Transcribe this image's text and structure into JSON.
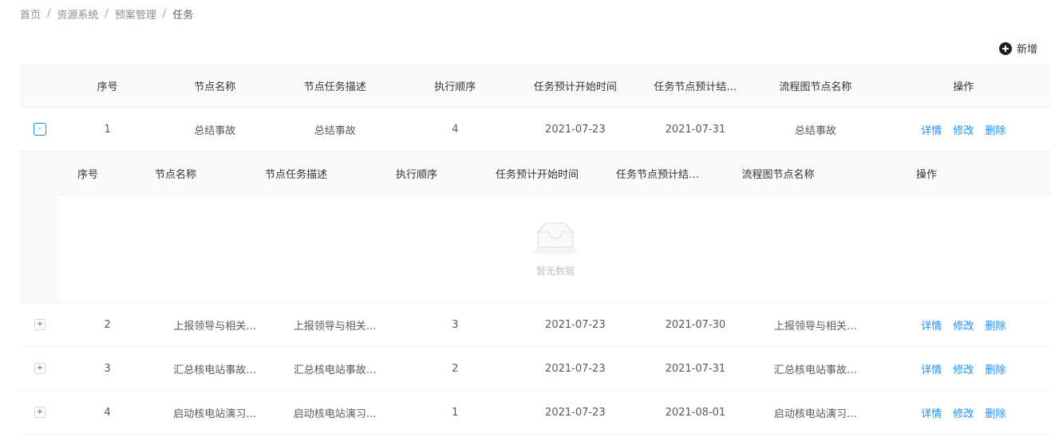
{
  "breadcrumb": {
    "items": [
      "首页",
      "资源系统",
      "预案管理",
      "任务"
    ],
    "separator": "/"
  },
  "toolbar": {
    "add_label": "新增"
  },
  "table": {
    "columns": [
      "序号",
      "节点名称",
      "节点任务描述",
      "执行顺序",
      "任务预计开始时间",
      "任务节点预计结…",
      "流程图节点名称",
      "操作"
    ],
    "rows": [
      {
        "expander": "-",
        "index": "1",
        "name": "总结事故",
        "desc": "总结事故",
        "order": "4",
        "start": "2021-07-23",
        "end": "2021-07-31",
        "flow": "总结事故",
        "ops": [
          "详情",
          "修改",
          "删除"
        ]
      },
      {
        "expander": "+",
        "index": "2",
        "name": "上报领导与相关…",
        "desc": "上报领导与相关…",
        "order": "3",
        "start": "2021-07-23",
        "end": "2021-07-30",
        "flow": "上报领导与相关…",
        "ops": [
          "详情",
          "修改",
          "删除"
        ]
      },
      {
        "expander": "+",
        "index": "3",
        "name": "汇总核电站事故…",
        "desc": "汇总核电站事故…",
        "order": "2",
        "start": "2021-07-23",
        "end": "2021-07-31",
        "flow": "汇总核电站事故…",
        "ops": [
          "详情",
          "修改",
          "删除"
        ]
      },
      {
        "expander": "+",
        "index": "4",
        "name": "启动核电站演习…",
        "desc": "启动核电站演习…",
        "order": "1",
        "start": "2021-07-23",
        "end": "2021-08-01",
        "flow": "启动核电站演习…",
        "ops": [
          "详情",
          "修改",
          "删除"
        ]
      }
    ]
  },
  "subtable": {
    "columns": [
      "序号",
      "节点名称",
      "节点任务描述",
      "执行顺序",
      "任务预计开始时间",
      "任务节点预计结…",
      "流程图节点名称",
      "操作"
    ],
    "empty_text": "暂无数据"
  },
  "colors": {
    "link": "#1890ff",
    "header_bg": "#fafafa",
    "border": "#efefef"
  }
}
